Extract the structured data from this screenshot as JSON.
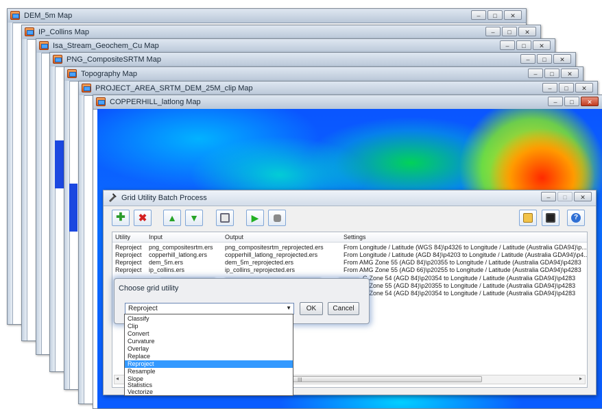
{
  "map_windows": [
    {
      "title": "DEM_5m Map"
    },
    {
      "title": "IP_Collins Map"
    },
    {
      "title": "Isa_Stream_Geochem_Cu Map"
    },
    {
      "title": "PNG_CompositeSRTM Map"
    },
    {
      "title": "Topography Map"
    },
    {
      "title": "PROJECT_AREA_SRTM_DEM_25M_clip Map"
    },
    {
      "title": "COPPERHILL_latlong Map"
    }
  ],
  "window_controls": {
    "minimize": "–",
    "maximize": "□",
    "close": "✕"
  },
  "batch_dialog": {
    "title": "Grid Utility Batch Process",
    "toolbar_icons": [
      "add-icon",
      "delete-icon",
      "move-up-icon",
      "move-down-icon",
      "properties-icon",
      "run-icon",
      "stop-icon",
      "open-icon",
      "save-icon",
      "help-icon"
    ],
    "columns": [
      "Utility",
      "Input",
      "Output",
      "Settings"
    ],
    "rows": [
      {
        "utility": "Reproject",
        "input": "png_compositesrtm.ers",
        "output": "png_compositesrtm_reprojected.ers",
        "settings": "From Longitude / Latitude (WGS 84)\\p4326 to Longitude / Latitude (Australia GDA94)\\p..."
      },
      {
        "utility": "Reproject",
        "input": "copperhill_latlong.ers",
        "output": "copperhill_latlong_reprojected.ers",
        "settings": "From Longitude / Latitude (AGD 84)\\p4203 to Longitude / Latitude (Australia GDA94)\\p4..."
      },
      {
        "utility": "Reproject",
        "input": "dem_5m.ers",
        "output": "dem_5m_reprojected.ers",
        "settings": "From AMG Zone 55 (AGD 84)\\p20355 to Longitude / Latitude (Australia GDA94)\\p4283"
      },
      {
        "utility": "Reproject",
        "input": "ip_collins.ers",
        "output": "ip_collins_reprojected.ers",
        "settings": "From AMG Zone 55 (AGD 66)\\p20255 to Longitude / Latitude (Australia GDA94)\\p4283"
      },
      {
        "utility": "",
        "input": "",
        "output": "",
        "settings": "G Zone 54 (AGD 84)\\p20354 to Longitude / Latitude (Australia GDA94)\\p4283"
      },
      {
        "utility": "",
        "input": "",
        "output": "",
        "settings": "G Zone 55 (AGD 84)\\p20355 to Longitude / Latitude (Australia GDA94)\\p4283"
      },
      {
        "utility": "",
        "input": "",
        "output": "",
        "settings": "G Zone 54 (AGD 84)\\p20354 to Longitude / Latitude (Australia GDA94)\\p4283"
      }
    ],
    "scroll": {
      "left": "◂",
      "right": "▸",
      "grip": "III"
    }
  },
  "chooser": {
    "title": "Choose grid utility",
    "selected": "Reproject",
    "arrow": "▼",
    "ok": "OK",
    "cancel": "Cancel",
    "options": [
      "Classify",
      "Clip",
      "Convert",
      "Curvature",
      "Overlay",
      "Replace",
      "Reproject",
      "Resample",
      "Slope",
      "Statistics",
      "Vectorize"
    ]
  }
}
